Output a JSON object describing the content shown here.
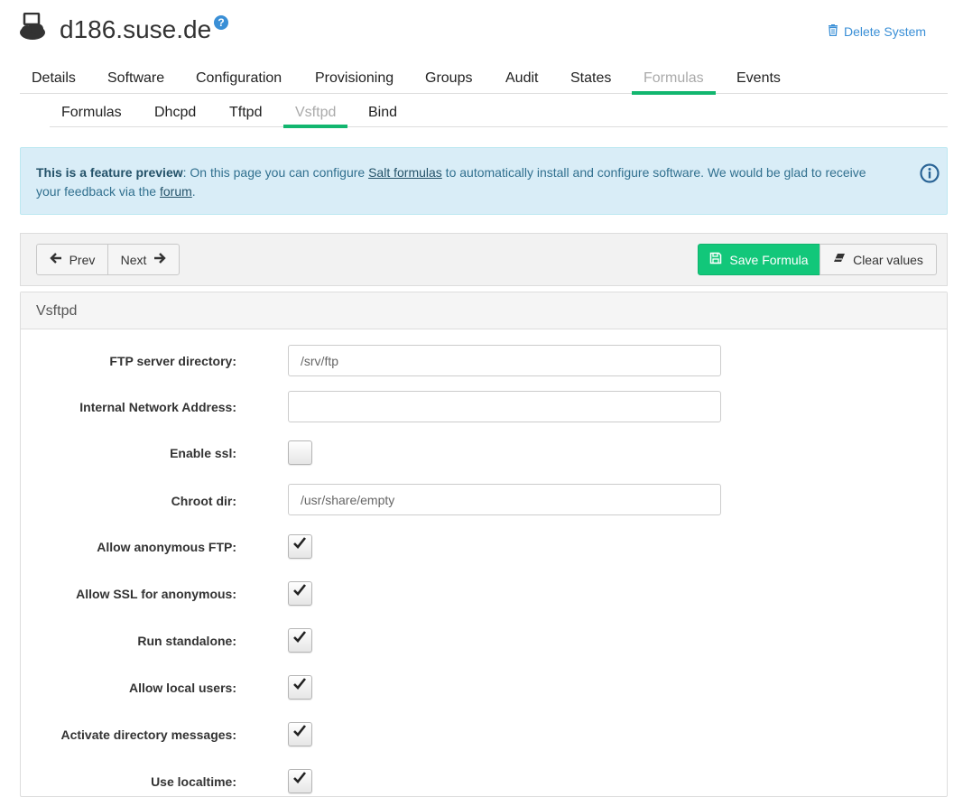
{
  "header": {
    "title": "d186.suse.de",
    "system_icon": "system-icon",
    "help_icon": "question-icon",
    "help_text": "?",
    "delete_label": "Delete System",
    "delete_icon": "trash-icon"
  },
  "tabs": [
    "Details",
    "Software",
    "Configuration",
    "Provisioning",
    "Groups",
    "Audit",
    "States",
    "Formulas",
    "Events"
  ],
  "active_tab": "Formulas",
  "subtabs": [
    "Formulas",
    "Dhcpd",
    "Tftpd",
    "Vsftpd",
    "Bind"
  ],
  "active_subtab": "Vsftpd",
  "alert": {
    "bold": "This is a feature preview",
    "text1": ": On this page you can configure ",
    "link1": "Salt formulas",
    "text2": " to automatically install and configure software. We would be glad to receive your feedback via the ",
    "link2": "forum",
    "text3": ".",
    "icon": "info-icon"
  },
  "toolbar": {
    "prev_label": "Prev",
    "next_label": "Next",
    "save_label": "Save Formula",
    "clear_label": "Clear values"
  },
  "panel": {
    "title": "Vsftpd",
    "fields": [
      {
        "label": "FTP server directory:",
        "type": "text",
        "value": "/srv/ftp"
      },
      {
        "label": "Internal Network Address:",
        "type": "text",
        "value": ""
      },
      {
        "label": "Enable ssl:",
        "type": "checkbox",
        "checked": false
      },
      {
        "label": "Chroot dir:",
        "type": "text",
        "value": "/usr/share/empty"
      },
      {
        "label": "Allow anonymous FTP:",
        "type": "checkbox",
        "checked": true
      },
      {
        "label": "Allow SSL for anonymous:",
        "type": "checkbox",
        "checked": true
      },
      {
        "label": "Run standalone:",
        "type": "checkbox",
        "checked": true
      },
      {
        "label": "Allow local users:",
        "type": "checkbox",
        "checked": true
      },
      {
        "label": "Activate directory messages:",
        "type": "checkbox",
        "checked": true
      },
      {
        "label": "Use localtime:",
        "type": "checkbox",
        "checked": true
      }
    ]
  },
  "colors": {
    "accent": "#12b66f",
    "link": "#3a8fd6",
    "alert_bg": "#d9edf7",
    "save_button": "#12c77a"
  }
}
